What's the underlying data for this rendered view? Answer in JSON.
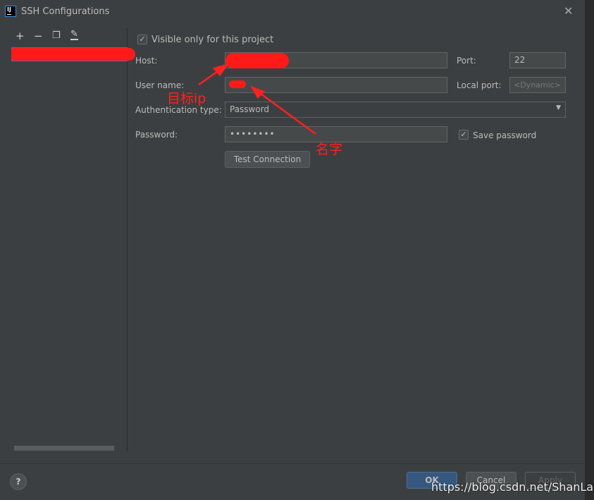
{
  "window": {
    "title": "SSH Configurations",
    "logo": "IJ"
  },
  "toolbar": {
    "add": "+",
    "remove": "−",
    "copy_icon": "copy-icon",
    "edit_icon": "edit-icon"
  },
  "form": {
    "visible_only": "Visible only for this project",
    "visible_checked": true,
    "host_label": "Host:",
    "host_value": "",
    "port_label": "Port:",
    "port_value": "22",
    "user_label": "User name:",
    "user_value": "",
    "local_port_label": "Local port:",
    "local_port_placeholder": "<Dynamic>",
    "auth_label": "Authentication type:",
    "auth_value": "Password",
    "password_label": "Password:",
    "password_value": "••••••••",
    "save_password": "Save password",
    "save_checked": true,
    "test_connection": "Test Connection"
  },
  "annotations": {
    "ip": "目标ip",
    "name": "名字"
  },
  "footer": {
    "help": "?",
    "ok": "OK",
    "cancel": "Cancel",
    "apply": "Apply"
  },
  "watermark": "https://blog.csdn.net/ShanLanF"
}
